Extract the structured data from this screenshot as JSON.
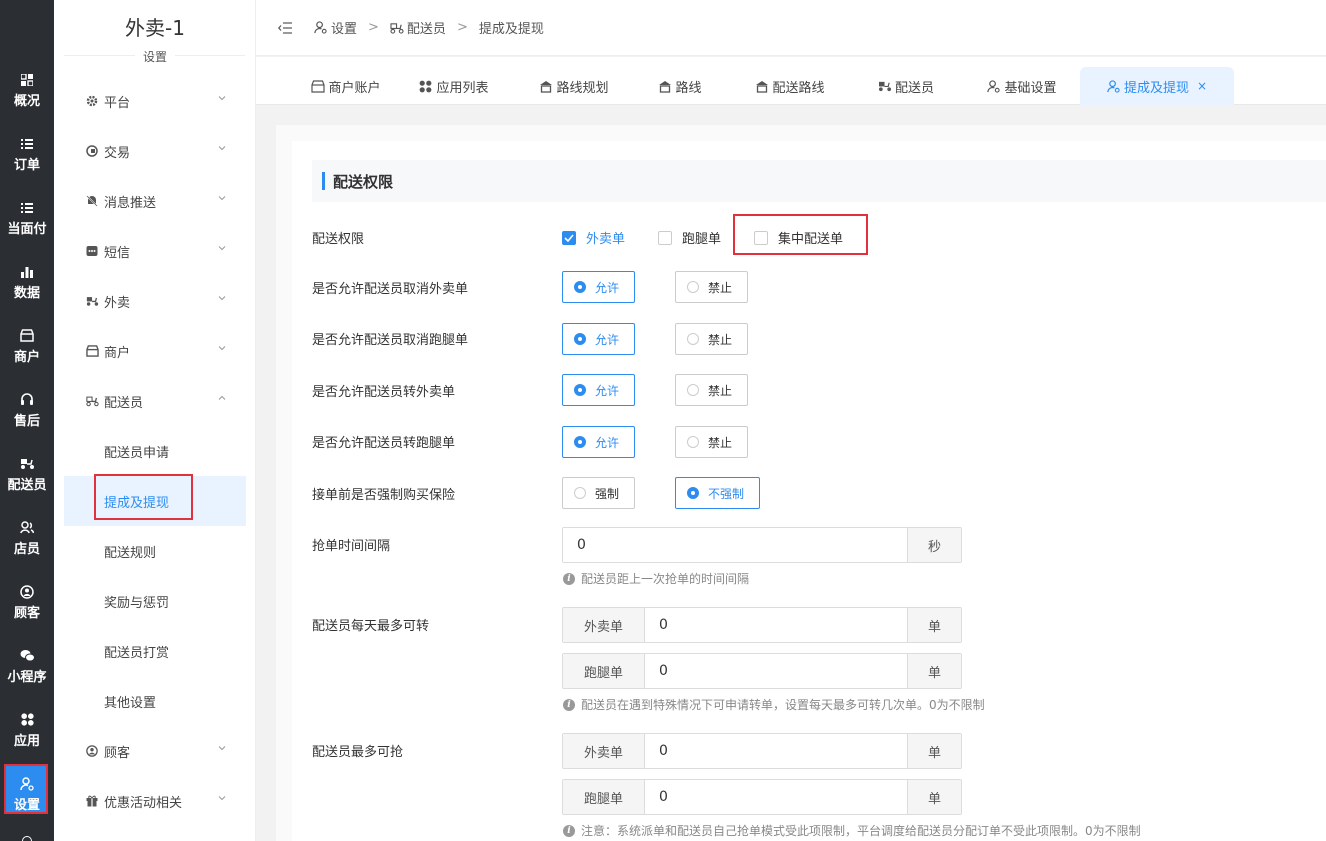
{
  "rail": {
    "items": [
      {
        "label": "概况",
        "icon": "dashboard-icon"
      },
      {
        "label": "订单",
        "icon": "list-icon"
      },
      {
        "label": "当面付",
        "icon": "list-icon"
      },
      {
        "label": "数据",
        "icon": "bar-chart-icon"
      },
      {
        "label": "商户",
        "icon": "store-icon"
      },
      {
        "label": "售后",
        "icon": "headset-icon"
      },
      {
        "label": "配送员",
        "icon": "scooter-icon"
      },
      {
        "label": "店员",
        "icon": "users-icon"
      },
      {
        "label": "顾客",
        "icon": "user-circle-icon"
      },
      {
        "label": "小程序",
        "icon": "wechat-icon"
      },
      {
        "label": "应用",
        "icon": "apps-icon"
      },
      {
        "label": "设置",
        "icon": "user-gear-icon"
      }
    ]
  },
  "sidebar": {
    "title": "外卖-1",
    "subtitle": "设置",
    "menus": [
      {
        "label": "平台",
        "icon": "gear-icon"
      },
      {
        "label": "交易",
        "icon": "wallet-icon"
      },
      {
        "label": "消息推送",
        "icon": "bell-off-icon"
      },
      {
        "label": "短信",
        "icon": "message-icon"
      },
      {
        "label": "外卖",
        "icon": "scooter-icon"
      },
      {
        "label": "商户",
        "icon": "store-icon"
      },
      {
        "label": "配送员",
        "icon": "scooter-icon"
      }
    ],
    "submenus": [
      {
        "label": "配送员申请"
      },
      {
        "label": "提成及提现"
      },
      {
        "label": "配送规则"
      },
      {
        "label": "奖励与惩罚"
      },
      {
        "label": "配送员打赏"
      },
      {
        "label": "其他设置"
      }
    ],
    "menus_after": [
      {
        "label": "顾客",
        "icon": "user-circle-icon"
      },
      {
        "label": "优惠活动相关",
        "icon": "gift-icon"
      }
    ]
  },
  "breadcrumb": {
    "items": [
      "设置",
      "配送员",
      "提成及提现"
    ],
    "separator": ">"
  },
  "tabs": [
    {
      "label": "商户账户",
      "icon": "store-icon"
    },
    {
      "label": "应用列表",
      "icon": "apps-icon"
    },
    {
      "label": "路线规划",
      "icon": "route-icon"
    },
    {
      "label": "路线",
      "icon": "route-icon"
    },
    {
      "label": "配送路线",
      "icon": "route-icon"
    },
    {
      "label": "配送员",
      "icon": "scooter-icon"
    },
    {
      "label": "基础设置",
      "icon": "user-gear-icon"
    },
    {
      "label": "提成及提现",
      "icon": "user-gear-icon",
      "close": "×"
    }
  ],
  "section": {
    "title": "配送权限"
  },
  "form": {
    "permission": {
      "label": "配送权限",
      "options": [
        "外卖单",
        "跑腿单",
        "集中配送单"
      ]
    },
    "cancel_takeout": {
      "label": "是否允许配送员取消外卖单",
      "allow": "允许",
      "deny": "禁止"
    },
    "cancel_errand": {
      "label": "是否允许配送员取消跑腿单",
      "allow": "允许",
      "deny": "禁止"
    },
    "transfer_takeout": {
      "label": "是否允许配送员转外卖单",
      "allow": "允许",
      "deny": "禁止"
    },
    "transfer_errand": {
      "label": "是否允许配送员转跑腿单",
      "allow": "允许",
      "deny": "禁止"
    },
    "insurance": {
      "label": "接单前是否强制购买保险",
      "force": "强制",
      "no_force": "不强制"
    },
    "grab_interval": {
      "label": "抢单时间间隔",
      "value": "0",
      "suffix": "秒",
      "hint": "配送员距上一次抢单的时间间隔"
    },
    "daily_transfer": {
      "label": "配送员每天最多可转",
      "takeout_prefix": "外卖单",
      "takeout_value": "0",
      "errand_prefix": "跑腿单",
      "errand_value": "0",
      "suffix": "单",
      "hint": "配送员在遇到特殊情况下可申请转单，设置每天最多可转几次单。0为不限制"
    },
    "max_grab": {
      "label": "配送员最多可抢",
      "takeout_prefix": "外卖单",
      "takeout_value": "0",
      "errand_prefix": "跑腿单",
      "errand_value": "0",
      "suffix": "单",
      "hint": "注意：系统派单和配送员自己抢单模式受此项限制，平台调度给配送员分配订单不受此项限制。0为不限制"
    }
  },
  "colors": {
    "accent": "#2d8cf0",
    "rail_bg": "#2b2e33",
    "highlight": "#e0313c"
  }
}
